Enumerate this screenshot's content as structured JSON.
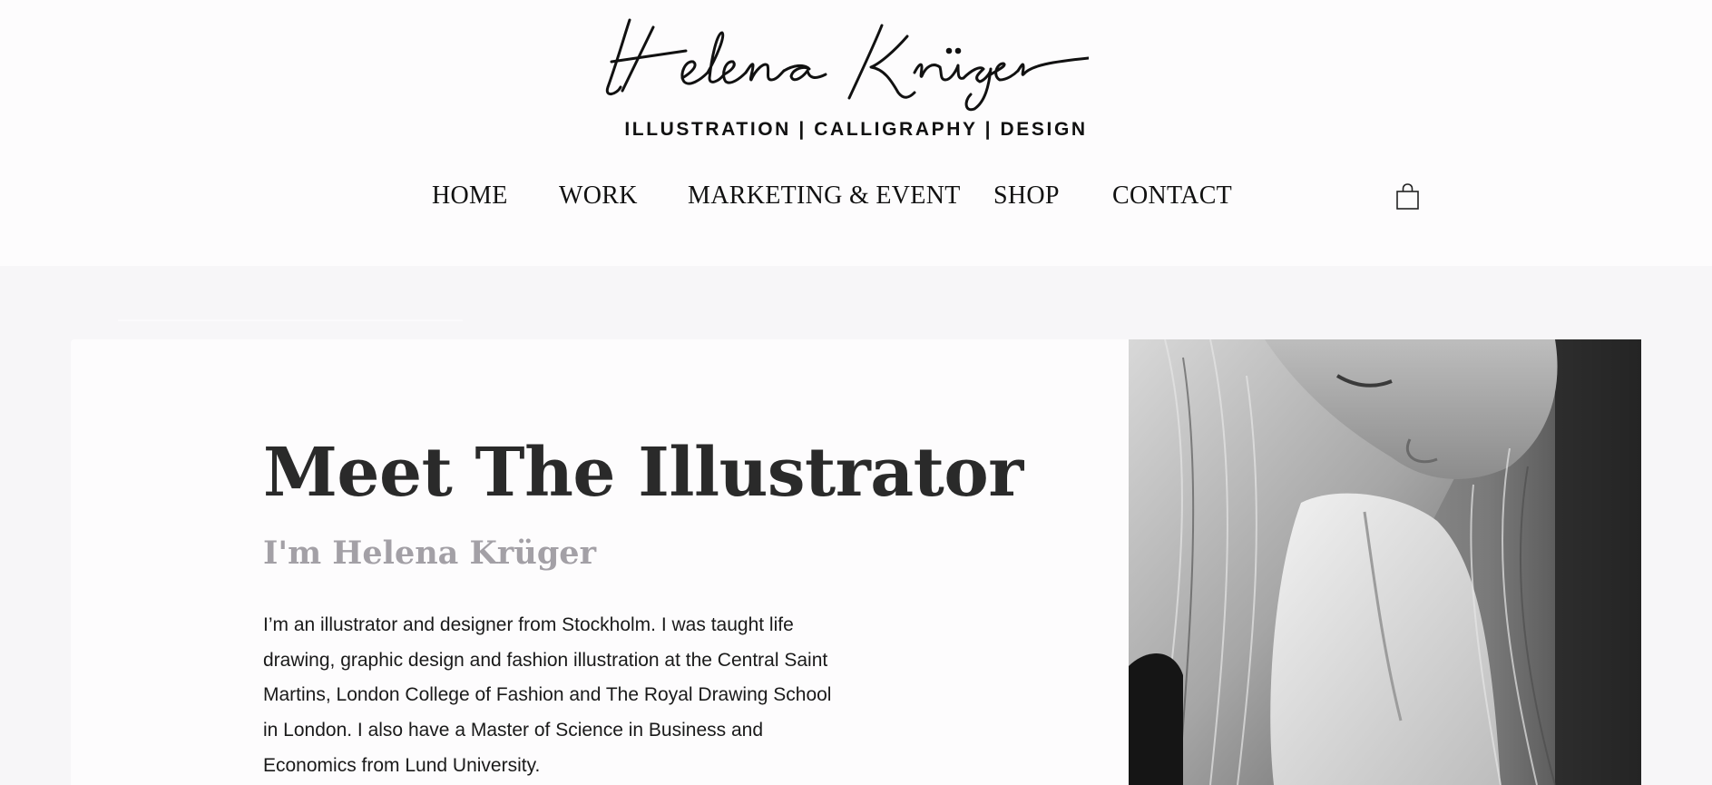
{
  "header": {
    "logo_name": "Helena Krüger",
    "tagline": "ILLUSTRATION | CALLIGRAPHY | DESIGN"
  },
  "nav": {
    "items": [
      {
        "label": "HOME"
      },
      {
        "label": "WORK"
      },
      {
        "label": "MARKETING & EVENT"
      },
      {
        "label": "SHOP"
      },
      {
        "label": "CONTACT"
      }
    ],
    "cart_icon": "shopping-bag-icon"
  },
  "about": {
    "title": "Meet The Illustrator",
    "subtitle": "I'm Helena Krüger",
    "bio": "I’m an illustrator and designer from Stockholm. I was taught life drawing, graphic design and fashion illustration at the Central Saint Martins, London College of Fashion and The Royal Drawing School in London. I also have a Master of Science in Business and Economics from Lund University."
  },
  "colors": {
    "background": "#f7f6f8",
    "card": "#fdfcfd",
    "text": "#1c1c1c",
    "subtitle": "#a3a0a6"
  }
}
